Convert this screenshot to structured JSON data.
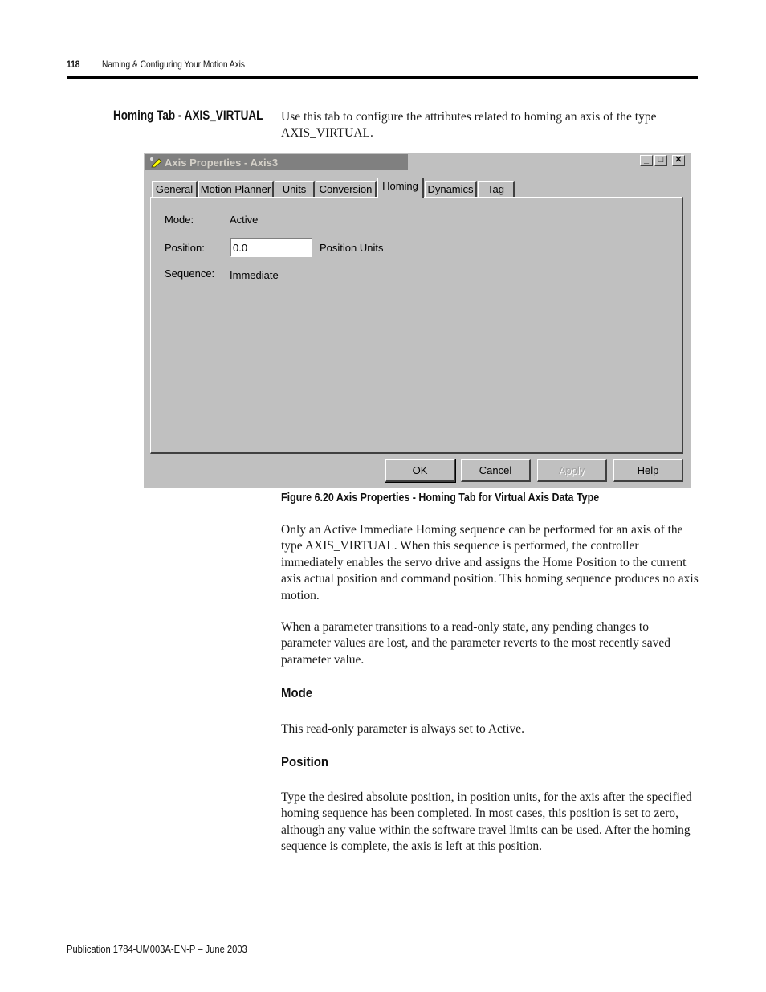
{
  "page_header": {
    "page_number": "118",
    "chapter_title": "Naming & Configuring Your Motion Axis"
  },
  "section": {
    "side_heading": "Homing Tab - AXIS_VIRTUAL",
    "intro": "Use this tab to configure the attributes related to homing an axis of the type AXIS_VIRTUAL."
  },
  "dialog": {
    "title": "Axis Properties - Axis3",
    "title_icon": "pencil-axis-icon",
    "window_controls": {
      "minimize": "_",
      "maximize": "□",
      "close": "✕"
    },
    "tabs": [
      {
        "label": "General",
        "active": false
      },
      {
        "label": "Motion Planner",
        "active": false
      },
      {
        "label": "Units",
        "active": false
      },
      {
        "label": "Conversion",
        "active": false
      },
      {
        "label": "Homing",
        "active": true
      },
      {
        "label": "Dynamics",
        "active": false
      },
      {
        "label": "Tag",
        "active": false
      }
    ],
    "fields": {
      "mode_label": "Mode:",
      "mode_value": "Active",
      "position_label": "Position:",
      "position_value": "0.0",
      "position_units": "Position Units",
      "sequence_label": "Sequence:",
      "sequence_value": "Immediate"
    },
    "buttons": {
      "ok": "OK",
      "cancel": "Cancel",
      "apply": "Apply",
      "apply_disabled": true,
      "help": "Help"
    }
  },
  "figure_caption": "Figure 6.20 Axis Properties - Homing Tab for Virtual Axis Data Type",
  "paragraphs": {
    "p1": "Only an Active Immediate Homing sequence can be performed for an axis of the type AXIS_VIRTUAL. When this sequence is performed, the controller immediately enables the servo drive and assigns the Home Position to the current axis actual position and command position. This homing sequence produces no axis motion.",
    "p2": "When a parameter transitions to a read-only state, any pending changes to parameter values are lost, and the parameter reverts to the most recently saved parameter value."
  },
  "subsections": {
    "mode": {
      "heading": "Mode",
      "text": "This read-only parameter is always set to Active."
    },
    "position": {
      "heading": "Position",
      "text": "Type the desired absolute position, in position units, for the axis after the specified homing sequence has been completed. In most cases, this position is set to zero, although any value within the software travel limits can be used. After the homing sequence is complete, the axis is left at this position."
    }
  },
  "footer": {
    "publication": "Publication 1784-UM003A-EN-P – June 2003"
  }
}
